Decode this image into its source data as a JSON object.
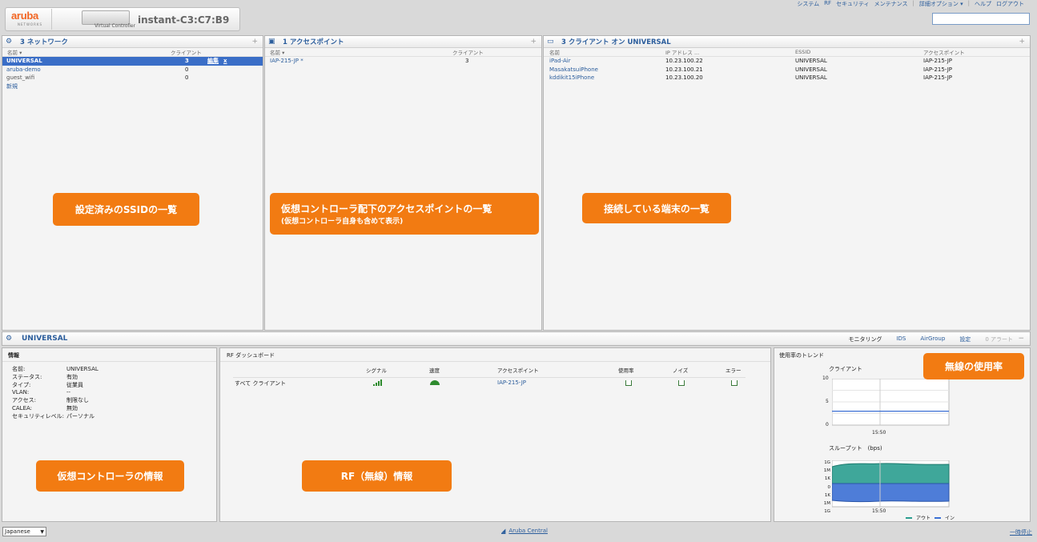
{
  "header": {
    "logo_text": "aruba",
    "logo_sub": "NETWORKS",
    "vc_label": "Virtual Controller",
    "instance": "instant-C3:C7:B9"
  },
  "topnav": {
    "items": [
      "システム",
      "RF",
      "セキュリティ",
      "メンテナンス"
    ],
    "advanced": "詳細オプション ▾",
    "help": "ヘルプ",
    "logout": "ログアウト"
  },
  "networks": {
    "title": "3 ネットワーク",
    "col_name": "名前 ▾",
    "col_clients": "クライアント",
    "rows": [
      {
        "name": "UNIVERSAL",
        "clients": "3",
        "edit": "編集",
        "del": "x"
      },
      {
        "name": "aruba-demo",
        "clients": "0"
      },
      {
        "name": "guest_wifi",
        "clients": "0"
      }
    ],
    "new_link": "新規"
  },
  "aps": {
    "title": "1 アクセスポイント",
    "col_name": "名前 ▾",
    "col_clients": "クライアント",
    "rows": [
      {
        "name": "IAP-215-JP *",
        "clients": "3"
      }
    ]
  },
  "clients": {
    "title": "3 クライアント オン UNIVERSAL",
    "cols": [
      "名前",
      "IP アドレス ...",
      "ESSID",
      "アクセスポイント"
    ],
    "rows": [
      [
        "iPad-Air",
        "10.23.100.22",
        "UNIVERSAL",
        "IAP-215-JP"
      ],
      [
        "MasakatsuiPhone",
        "10.23.100.21",
        "UNIVERSAL",
        "IAP-215-JP"
      ],
      [
        "kddikit15iPhone",
        "10.23.100.20",
        "UNIVERSAL",
        "IAP-215-JP"
      ]
    ]
  },
  "callouts": {
    "ssid": "設定済みのSSIDの一覧",
    "ap": "仮想コントローラ配下のアクセスポイントの一覧",
    "ap_sub": "(仮想コントローラ自身も含めて表示)",
    "clients": "接続している端末の一覧",
    "vc_info": "仮想コントローラの情報",
    "rf": "RF（無線）情報",
    "usage": "無線の使用率"
  },
  "bottom": {
    "title": "UNIVERSAL",
    "tabs": [
      "モニタリング",
      "IDS",
      "AirGroup",
      "設定"
    ],
    "alerts": "0 アラート",
    "collapse": "−"
  },
  "info": {
    "title": "情報",
    "items": [
      {
        "k": "名前:",
        "v": "UNIVERSAL"
      },
      {
        "k": "ステータス:",
        "v": "有効"
      },
      {
        "k": "タイプ:",
        "v": "従業員"
      },
      {
        "k": "VLAN:",
        "v": "--"
      },
      {
        "k": "アクセス:",
        "v": "制限なし"
      },
      {
        "k": "CALEA:",
        "v": "無効"
      },
      {
        "k": "セキュリティレベル:",
        "v": "パーソナル"
      }
    ]
  },
  "rf": {
    "title": "RF ダッシュボード",
    "cols": [
      "シグナル",
      "速度",
      "アクセスポイント",
      "使用率",
      "ノイズ",
      "エラー"
    ],
    "row_label": "すべて クライアント",
    "row_ap": "IAP-215-JP"
  },
  "trend": {
    "title": "使用率のトレンド",
    "clients_label": "クライアント",
    "clients_y": [
      "10",
      "5",
      "0"
    ],
    "clients_value": 3,
    "clients_x": "15:50",
    "throughput_label": "スループット　(bps)",
    "throughput_y": [
      "1G",
      "1M",
      "1K",
      "0",
      "1K",
      "1M",
      "1G"
    ],
    "throughput_x": "15:50",
    "legend_out": "アウト",
    "legend_in": "イン",
    "color_out": "#2a9d8f",
    "color_in": "#3b6fd4"
  },
  "footer": {
    "language": "Japanese",
    "central": "Aruba Central",
    "pause": "一時停止"
  }
}
